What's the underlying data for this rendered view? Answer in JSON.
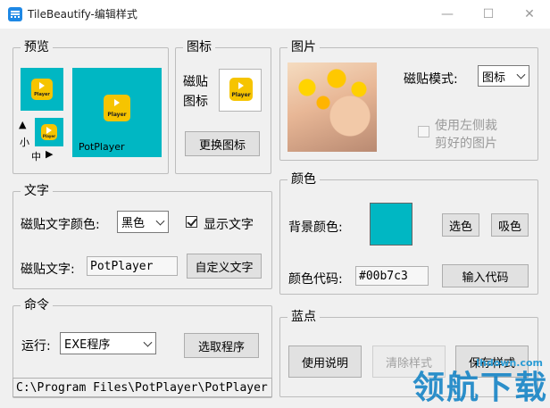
{
  "window": {
    "title": "TileBeautify-编辑样式",
    "minimize": "—",
    "maximize": "☐",
    "close": "✕"
  },
  "preview": {
    "legend": "预览",
    "tile_app_name": "PotPlayer",
    "small_label": "小",
    "medium_label": "中",
    "up_arrow": "▲",
    "right_arrow": "▶",
    "icon_text": "Player"
  },
  "icon_group": {
    "legend": "图标",
    "label_line1": "磁贴",
    "label_line2": "图标",
    "change_button": "更换图标"
  },
  "image_group": {
    "legend": "图片",
    "tile_mode_label": "磁贴模式:",
    "tile_mode_value": "图标",
    "use_left_line1": "使用左侧裁",
    "use_left_line2": "剪好的图片"
  },
  "text_group": {
    "legend": "文字",
    "color_label": "磁贴文字颜色:",
    "color_value": "黑色",
    "show_text_label": "显示文字",
    "text_label": "磁贴文字:",
    "text_value": "PotPlayer",
    "custom_button": "自定义文字"
  },
  "color_group": {
    "legend": "颜色",
    "bg_label": "背景颜色:",
    "swatch_color": "#00b7c3",
    "pick_button": "选色",
    "absorb_button": "吸色",
    "code_label": "颜色代码:",
    "code_value": "#00b7c3",
    "input_button": "输入代码"
  },
  "command_group": {
    "legend": "命令",
    "run_label": "运行:",
    "run_value": "EXE程序",
    "choose_button": "选取程序",
    "path": "C:\\Program Files\\PotPlayer\\PotPlayer"
  },
  "blue_dot_group": {
    "legend": "蓝点",
    "usage_button": "使用说明",
    "clear_button": "清除样式",
    "save_button": "保存样式"
  },
  "watermark": {
    "site": "lhdown.com",
    "brand": "领航下载"
  },
  "colors": {
    "tile_bg": "#00b7c3",
    "icon_yellow": "#f6c400"
  }
}
